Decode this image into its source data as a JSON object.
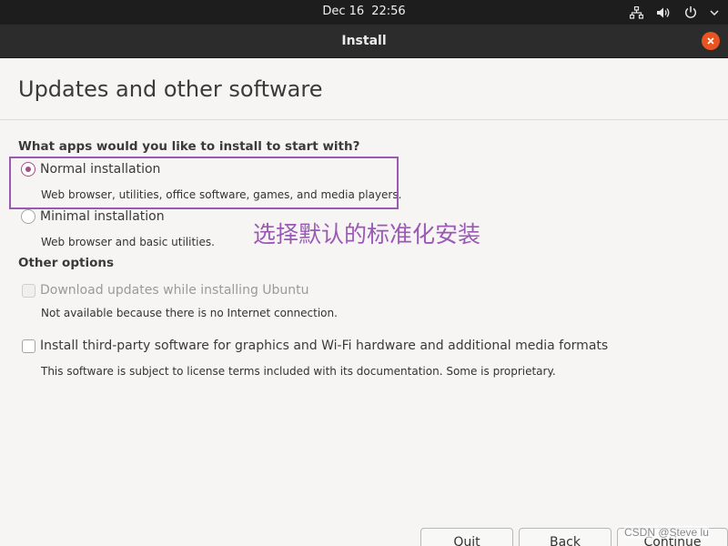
{
  "topbar": {
    "date": "Dec 16",
    "time": "22:56",
    "tray_icons": [
      "network-icon",
      "volume-icon",
      "power-icon",
      "chevron-down-icon"
    ]
  },
  "window": {
    "title": "Install"
  },
  "page": {
    "title": "Updates and other software",
    "question": "What apps would you like to install to start with?",
    "options": [
      {
        "label": "Normal installation",
        "description": "Web browser, utilities, office software, games, and media players.",
        "selected": true
      },
      {
        "label": "Minimal installation",
        "description": "Web browser and basic utilities.",
        "selected": false
      }
    ],
    "annotation": "选择默认的标准化安装",
    "other_options_heading": "Other options",
    "other_options": [
      {
        "label": "Download updates while installing Ubuntu",
        "description": "Not available because there is no Internet connection.",
        "checked": false,
        "disabled": true
      },
      {
        "label": "Install third-party software for graphics and Wi-Fi hardware and additional media formats",
        "description": "This software is subject to license terms included with its documentation. Some is proprietary.",
        "checked": false,
        "disabled": false
      }
    ]
  },
  "buttons": {
    "quit": "Quit",
    "back": "Back",
    "continue": "Continue"
  },
  "watermark": "CSDN @Steve lu",
  "colors": {
    "accent": "#e95420",
    "radio_selected": "#a24f86",
    "annotation": "#9b59b6",
    "topbar": "#1d1d1d",
    "headerbar": "#2c2c2c"
  }
}
